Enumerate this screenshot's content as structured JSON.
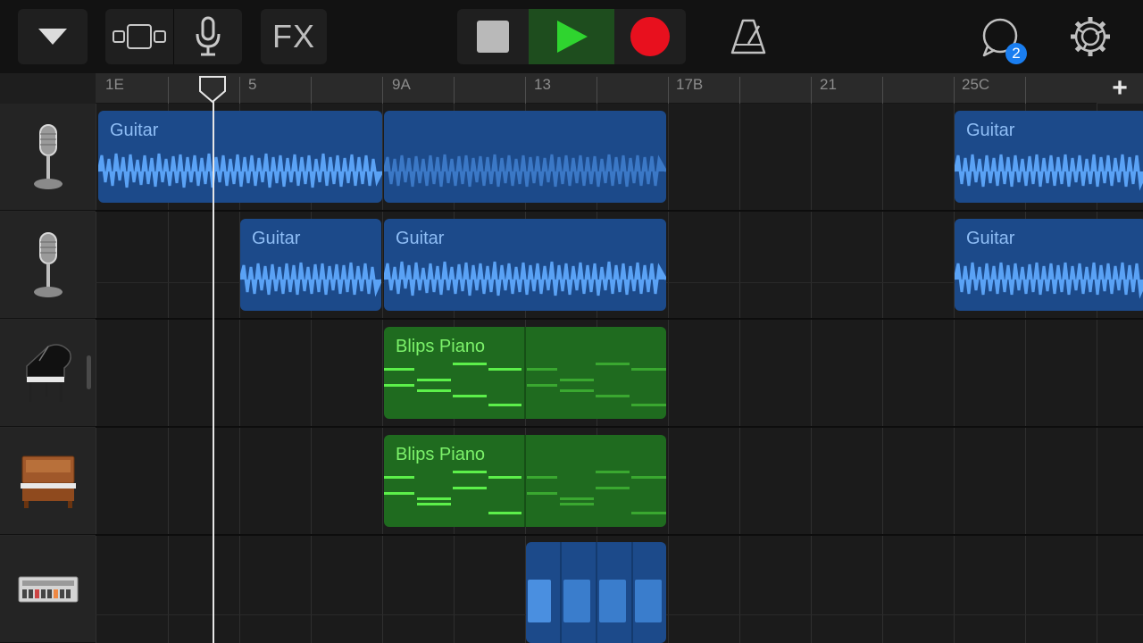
{
  "toolbar": {
    "fx_label": "FX",
    "loop_badge": "2",
    "colors": {
      "play_active": "#2fd42f",
      "record": "#e8101e",
      "badge": "#1a7ef0"
    }
  },
  "ruler": {
    "labels": [
      "1E",
      "5",
      "9A",
      "13",
      "17B",
      "21",
      "25C"
    ],
    "add_track_label": "+"
  },
  "tracks": [
    {
      "instrument": "microphone-icon"
    },
    {
      "instrument": "microphone-icon"
    },
    {
      "instrument": "grand-piano-icon"
    },
    {
      "instrument": "upright-piano-icon"
    },
    {
      "instrument": "drum-machine-icon"
    }
  ],
  "regions": {
    "t1_a": "Guitar",
    "t1_c": "Guitar",
    "t2_a": "Guitar",
    "t2_b": "Guitar",
    "t2_c": "Guitar",
    "t3_a": "Blips Piano",
    "t4_a": "Blips Piano"
  }
}
